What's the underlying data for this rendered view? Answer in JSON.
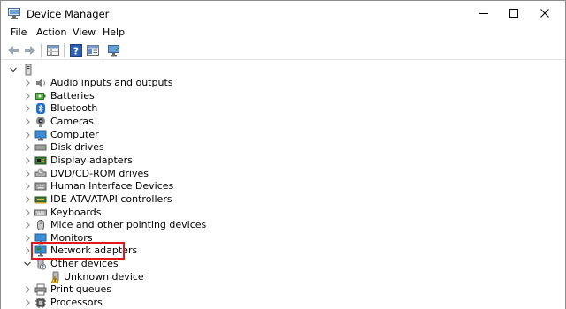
{
  "window": {
    "title": "Device Manager"
  },
  "menu": [
    "File",
    "Action",
    "View",
    "Help"
  ],
  "tree": {
    "root_expanded": true,
    "items": [
      {
        "label": "Audio inputs and outputs",
        "icon": "speaker-icon",
        "expanded": false
      },
      {
        "label": "Batteries",
        "icon": "battery-icon",
        "expanded": false
      },
      {
        "label": "Bluetooth",
        "icon": "bluetooth-icon",
        "expanded": false
      },
      {
        "label": "Cameras",
        "icon": "camera-icon",
        "expanded": false
      },
      {
        "label": "Computer",
        "icon": "monitor-icon",
        "expanded": false
      },
      {
        "label": "Disk drives",
        "icon": "disk-drive-icon",
        "expanded": false
      },
      {
        "label": "Display adapters",
        "icon": "display-adapter-icon",
        "expanded": false
      },
      {
        "label": "DVD/CD-ROM drives",
        "icon": "dvd-drive-icon",
        "expanded": false
      },
      {
        "label": "Human Interface Devices",
        "icon": "hid-icon",
        "expanded": false
      },
      {
        "label": "IDE ATA/ATAPI controllers",
        "icon": "ide-controller-icon",
        "expanded": false
      },
      {
        "label": "Keyboards",
        "icon": "keyboard-icon",
        "expanded": false
      },
      {
        "label": "Mice and other pointing devices",
        "icon": "mouse-icon",
        "expanded": false
      },
      {
        "label": "Monitors",
        "icon": "monitor-icon",
        "expanded": false
      },
      {
        "label": "Network adapters",
        "icon": "network-adapter-icon",
        "expanded": false,
        "highlighted": true
      },
      {
        "label": "Other devices",
        "icon": "other-devices-icon",
        "expanded": true
      },
      {
        "label": "Unknown device",
        "icon": "unknown-device-warning-icon",
        "child": true
      },
      {
        "label": "Print queues",
        "icon": "printer-icon",
        "expanded": false
      },
      {
        "label": "Processors",
        "icon": "processor-icon",
        "expanded": false
      }
    ]
  },
  "colors": {
    "highlight_border": "#e0191f"
  }
}
